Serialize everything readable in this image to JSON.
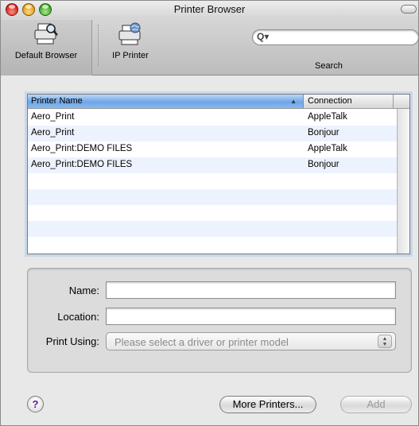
{
  "window": {
    "title": "Printer Browser"
  },
  "toolbar": {
    "default_browser_label": "Default Browser",
    "ip_printer_label": "IP Printer",
    "search_label": "Search",
    "search_placeholder": "",
    "search_value": ""
  },
  "table": {
    "columns": [
      "Printer Name",
      "Connection"
    ],
    "sort_column": "Printer Name",
    "rows": [
      {
        "name": "Aero_Print",
        "connection": "AppleTalk"
      },
      {
        "name": "Aero_Print",
        "connection": "Bonjour"
      },
      {
        "name": "Aero_Print:DEMO FILES",
        "connection": "AppleTalk"
      },
      {
        "name": "Aero_Print:DEMO FILES",
        "connection": "Bonjour"
      }
    ]
  },
  "form": {
    "name_label": "Name:",
    "name_value": "",
    "location_label": "Location:",
    "location_value": "",
    "print_using_label": "Print Using:",
    "print_using_value": "Please select a driver or printer model"
  },
  "buttons": {
    "help": "?",
    "more_printers": "More Printers...",
    "add": "Add"
  },
  "colors": {
    "header_selected": "#6ea6e8",
    "row_alt": "#edf3fe",
    "help_glyph": "#6a0fa0"
  }
}
